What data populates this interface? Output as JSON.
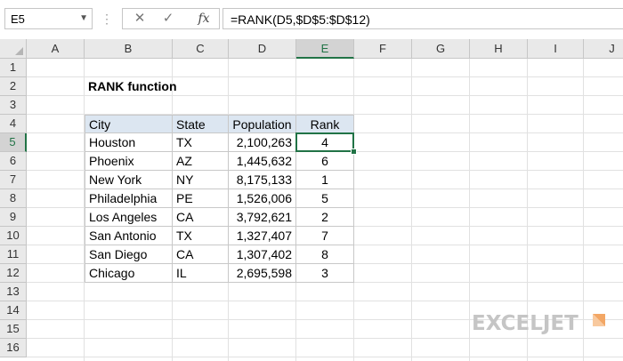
{
  "name_box": {
    "value": "E5"
  },
  "formula_bar": {
    "cancel_glyph": "✕",
    "enter_glyph": "✓",
    "fx_label": "fx",
    "formula": "=RANK(D5,$D$5:$D$12)"
  },
  "columns": [
    "A",
    "B",
    "C",
    "D",
    "E",
    "F",
    "G",
    "H",
    "I",
    "J"
  ],
  "rows": [
    "1",
    "2",
    "3",
    "4",
    "5",
    "6",
    "7",
    "8",
    "9",
    "10",
    "11",
    "12",
    "13",
    "14",
    "15",
    "16"
  ],
  "title": "RANK function",
  "table": {
    "headers": [
      "City",
      "State",
      "Population",
      "Rank"
    ],
    "rows": [
      [
        "Houston",
        "TX",
        "2,100,263",
        "4"
      ],
      [
        "Phoenix",
        "AZ",
        "1,445,632",
        "6"
      ],
      [
        "New York",
        "NY",
        "8,175,133",
        "1"
      ],
      [
        "Philadelphia",
        "PE",
        "1,526,006",
        "5"
      ],
      [
        "Los Angeles",
        "CA",
        "3,792,621",
        "2"
      ],
      [
        "San Antonio",
        "TX",
        "1,327,407",
        "7"
      ],
      [
        "San Diego",
        "CA",
        "1,307,402",
        "8"
      ],
      [
        "Chicago",
        "IL",
        "2,695,598",
        "3"
      ]
    ]
  },
  "selected_cell": "E5",
  "logo": {
    "text": "EXCELJET"
  },
  "colors": {
    "accent": "#217346",
    "header_fill": "#dce6f1",
    "logo": "#c5c5c5"
  }
}
